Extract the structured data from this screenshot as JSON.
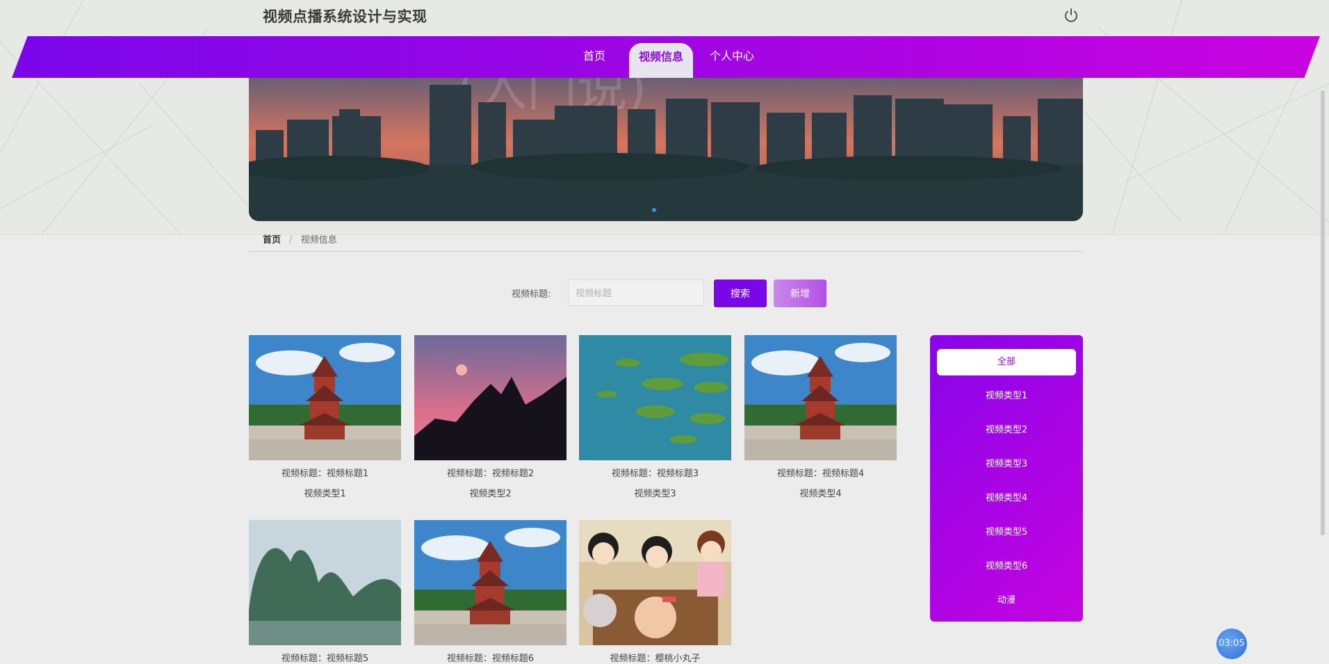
{
  "app": {
    "title": "视频点播系统设计与实现"
  },
  "nav": {
    "items": [
      {
        "label": "首页"
      },
      {
        "label": "视频信息"
      },
      {
        "label": "个人中心"
      }
    ],
    "active_index": 1
  },
  "banner": {
    "overlay_text": "(入门说)"
  },
  "breadcrumb": {
    "home": "首页",
    "separator": "/",
    "current": "视频信息"
  },
  "search": {
    "label": "视频标题:",
    "placeholder": "视频标题",
    "search_button": "搜索",
    "add_button": "新增"
  },
  "videos": [
    {
      "title": "视频标题：视频标题1",
      "type": "视频类型1",
      "scene": "pagoda"
    },
    {
      "title": "视频标题：视频标题2",
      "type": "视频类型2",
      "scene": "dusk-mountain"
    },
    {
      "title": "视频标题：视频标题3",
      "type": "视频类型3",
      "scene": "lake-islands"
    },
    {
      "title": "视频标题：视频标题4",
      "type": "视频类型4",
      "scene": "pagoda"
    },
    {
      "title": "视频标题：视频标题5",
      "type": "",
      "scene": "karst-river"
    },
    {
      "title": "视频标题：视频标题6",
      "type": "",
      "scene": "pagoda"
    },
    {
      "title": "视频标题：樱桃小丸子",
      "type": "",
      "scene": "cartoon"
    }
  ],
  "categories": {
    "items": [
      "全部",
      "视频类型1",
      "视频类型2",
      "视频类型3",
      "视频类型4",
      "视频类型5",
      "视频类型6",
      "动漫"
    ],
    "active_index": 0
  },
  "timer": {
    "label": "03:05"
  },
  "colors": {
    "accent": "#7a07e6",
    "nav_gradient_start": "#7b06ea",
    "nav_gradient_end": "#c804e0",
    "timer_badge": "#2c6fd6"
  },
  "icons": {
    "power": "power-icon"
  }
}
